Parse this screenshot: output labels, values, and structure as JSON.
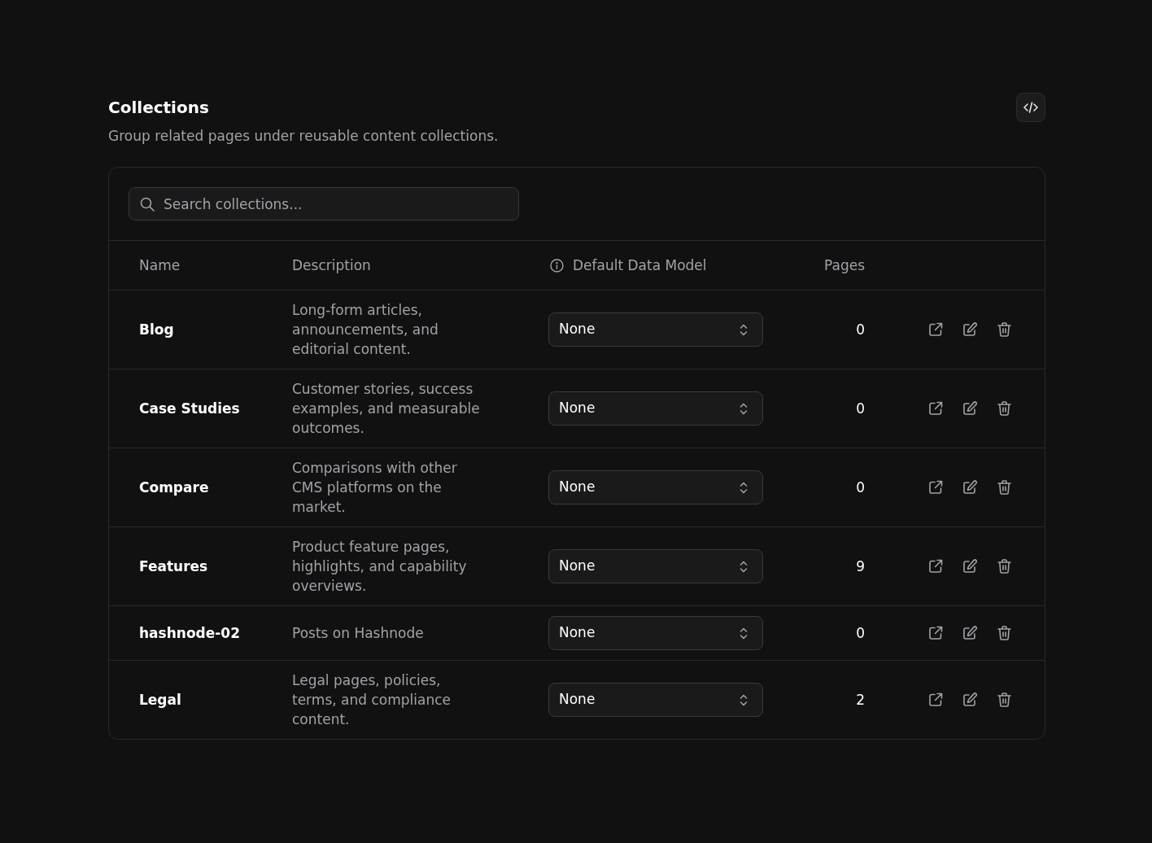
{
  "header": {
    "title": "Collections",
    "subtitle": "Group related pages under reusable content collections."
  },
  "search": {
    "placeholder": "Search collections..."
  },
  "table": {
    "columns": [
      {
        "label": "Name",
        "kind": "plain"
      },
      {
        "label": "Description",
        "kind": "plain"
      },
      {
        "label": "Default Data Model",
        "kind": "info"
      },
      {
        "label": "Pages",
        "kind": "number"
      }
    ],
    "rows": [
      {
        "name": "Blog",
        "description": "Long-form articles, announcements, and editorial content.",
        "data_model": "None",
        "pages": "0"
      },
      {
        "name": "Case Studies",
        "description": "Customer stories, success examples, and measurable outcomes.",
        "data_model": "None",
        "pages": "0"
      },
      {
        "name": "Compare",
        "description": "Comparisons with other CMS platforms on the market.",
        "data_model": "None",
        "pages": "0"
      },
      {
        "name": "Features",
        "description": "Product feature pages, highlights, and capability overviews.",
        "data_model": "None",
        "pages": "9"
      },
      {
        "name": "hashnode-02",
        "description": "Posts on Hashnode",
        "data_model": "None",
        "pages": "0"
      },
      {
        "name": "Legal",
        "description": "Legal pages, policies, terms, and compliance content.",
        "data_model": "None",
        "pages": "2"
      }
    ]
  }
}
